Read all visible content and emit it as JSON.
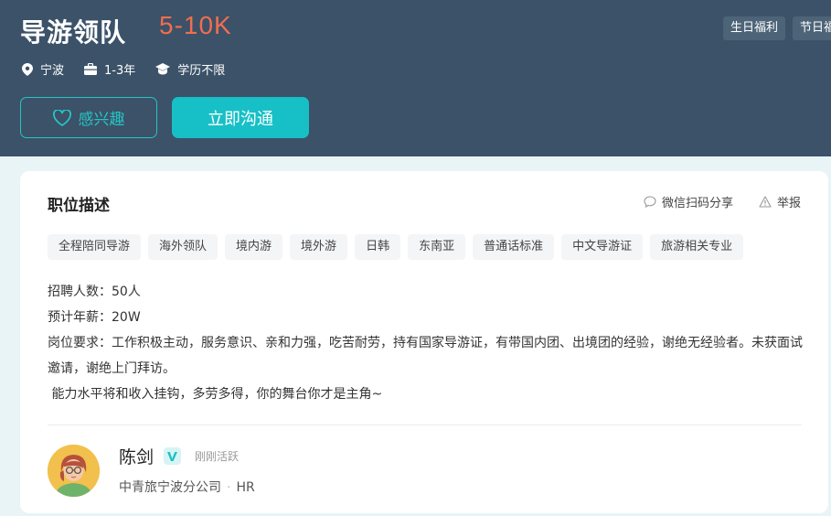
{
  "header": {
    "title": "导游领队",
    "salary": "5-10K",
    "benefits": [
      "生日福利",
      "节日福"
    ],
    "meta": {
      "location": "宁波",
      "experience": "1-3年",
      "education": "学历不限"
    },
    "interest_label": "感兴趣",
    "chat_label": "立即沟通"
  },
  "card": {
    "section_title": "职位描述",
    "share_label": "微信扫码分享",
    "report_label": "举报",
    "skills": [
      "全程陪同导游",
      "海外领队",
      "境内游",
      "境外游",
      "日韩",
      "东南亚",
      "普通话标准",
      "中文导游证",
      "旅游相关专业"
    ],
    "description": [
      "招聘人数：50人",
      "预计年薪：20W",
      "岗位要求：工作积极主动，服务意识、亲和力强，吃苦耐劳，持有国家导游证，有带国内团、出境团的经验，谢绝无经验者。未获面试邀请，谢绝上门拜访。",
      " 能力水平将和收入挂钩，多劳多得，你的舞台你才是主角~"
    ]
  },
  "recruiter": {
    "name": "陈剑",
    "status": "刚刚活跃",
    "company": "中青旅宁波分公司",
    "role": "HR"
  },
  "colors": {
    "header_bg": "#3b5268",
    "salary": "#f26d4f",
    "accent": "#17c0c6"
  }
}
